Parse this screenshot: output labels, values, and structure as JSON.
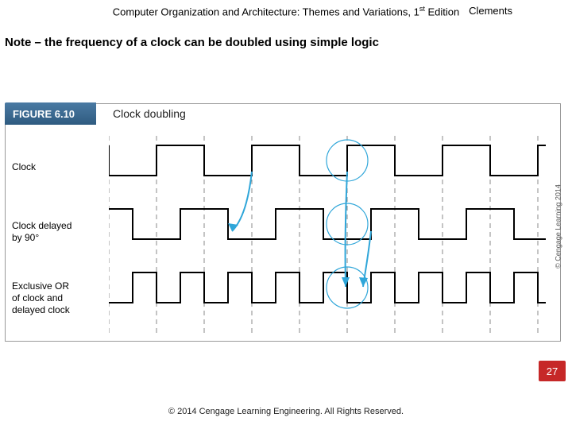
{
  "header": {
    "book_title_pre": "Computer Organization and Architecture: Themes and Variations, 1",
    "book_title_sup": "st",
    "book_title_post": " Edition",
    "author": "Clements"
  },
  "note": "Note – the frequency of a clock can be doubled using simple logic",
  "figure": {
    "label": "FIGURE 6.10",
    "title": "Clock doubling",
    "row1": "Clock",
    "row2_line1": "Clock delayed",
    "row2_line2": "by 90°",
    "row3_line1": "Exclusive OR",
    "row3_line2": "of clock and",
    "row3_line3": "delayed clock",
    "side_copyright": "© Cengage Learning 2014"
  },
  "page_number": "27",
  "footer": "© 2014 Cengage Learning Engineering. All Rights Reserved."
}
